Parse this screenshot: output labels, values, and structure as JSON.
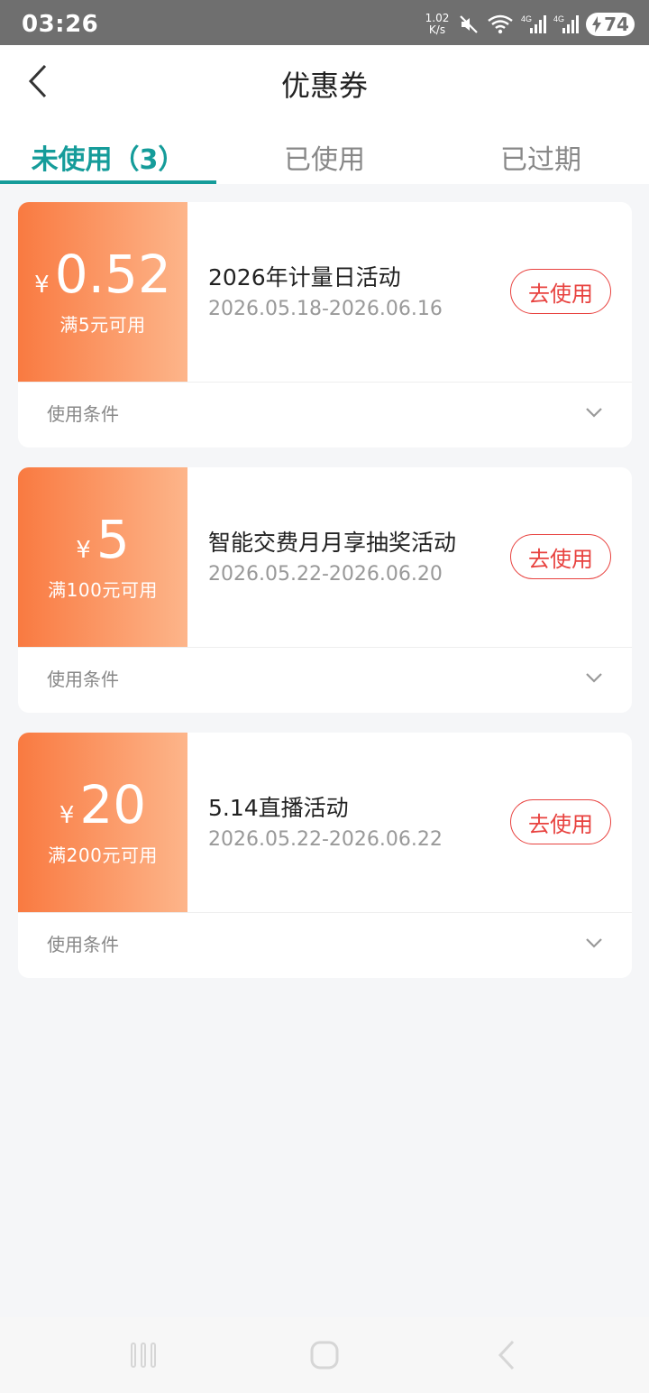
{
  "status_bar": {
    "time": "03:26",
    "net_speed_value": "1.02",
    "net_speed_unit": "K/s",
    "signal_1": "4G",
    "signal_2": "4G",
    "battery": "74",
    "icons": [
      "mute-icon",
      "wifi-icon",
      "signal-icon",
      "signal-icon",
      "battery-icon"
    ]
  },
  "header": {
    "title": "优惠券",
    "back_icon": "chevron-left-icon"
  },
  "tabs": [
    {
      "label": "未使用（3）",
      "active": true
    },
    {
      "label": "已使用",
      "active": false
    },
    {
      "label": "已过期",
      "active": false
    }
  ],
  "coupons": [
    {
      "currency": "¥",
      "amount": "0.52",
      "threshold": "满5元可用",
      "name": "2026年计量日活动",
      "date_range": "2026.05.18-2026.06.16",
      "button": "去使用",
      "conditions_label": "使用条件"
    },
    {
      "currency": "¥",
      "amount": "5",
      "threshold": "满100元可用",
      "name": "智能交费月月享抽奖活动",
      "date_range": "2026.05.22-2026.06.20",
      "button": "去使用",
      "conditions_label": "使用条件"
    },
    {
      "currency": "¥",
      "amount": "20",
      "threshold": "满200元可用",
      "name": "5.14直播活动",
      "date_range": "2026.05.22-2026.06.22",
      "button": "去使用",
      "conditions_label": "使用条件"
    }
  ],
  "colors": {
    "accent": "#159c9a",
    "coupon_gradient_start": "#f97a41",
    "coupon_gradient_end": "#fdb58a",
    "button_red": "#e8423f"
  },
  "nav_bar": {
    "icons": [
      "recent-apps-icon",
      "home-icon",
      "back-icon"
    ]
  }
}
